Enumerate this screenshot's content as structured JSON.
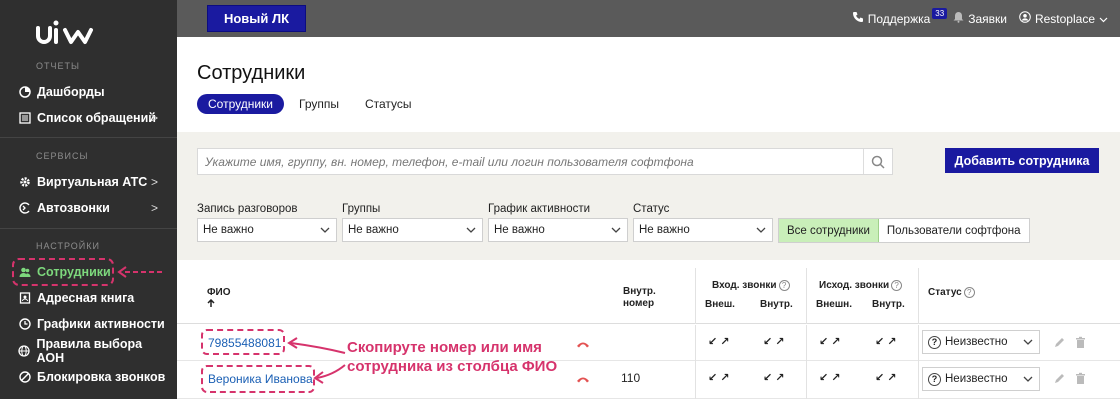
{
  "sidebar": {
    "logo_text": "uis",
    "sections": [
      {
        "title": "ОТЧЕТЫ"
      },
      {
        "title": "СЕРВИСЫ"
      },
      {
        "title": "НАСТРОЙКИ"
      }
    ],
    "items": [
      {
        "label": "Дашборды",
        "icon": "pie-chart-icon"
      },
      {
        "label": "Список обращений",
        "icon": "list-icon",
        "chevron": ">"
      },
      {
        "label": "Виртуальная АТС",
        "icon": "gear-icon",
        "chevron": ">"
      },
      {
        "label": "Автозвонки",
        "icon": "autocall-icon",
        "chevron": ">"
      },
      {
        "label": "Сотрудники",
        "icon": "users-icon"
      },
      {
        "label": "Адресная книга",
        "icon": "book-icon"
      },
      {
        "label": "Графики активности",
        "icon": "clock-icon"
      },
      {
        "label": "Правила выбора АОН",
        "icon": "globe-icon"
      },
      {
        "label": "Блокировка звонков",
        "icon": "block-icon"
      }
    ]
  },
  "topbar": {
    "new_lk": "Новый ЛК",
    "support": "Поддержка",
    "badge": "33",
    "requests": "Заявки",
    "account": "Restoplace"
  },
  "page": {
    "title": "Сотрудники",
    "tabs": [
      "Сотрудники",
      "Группы",
      "Статусы"
    ]
  },
  "filters": {
    "search_placeholder": "Укажите имя, группу, вн. номер, телефон, e-mail или логин пользователя софтфона",
    "add_button": "Добавить сотрудника",
    "labels": [
      "Запись разговоров",
      "Группы",
      "График активности",
      "Статус"
    ],
    "values": [
      "Не важно",
      "Не важно",
      "Не важно",
      "Не важно"
    ],
    "segment": [
      "Все сотрудники",
      "Пользователи софтфона"
    ]
  },
  "table": {
    "headers": {
      "fio": "ФИО",
      "sort": "🠙",
      "ext_1": "Внутр.",
      "ext_2": "номер",
      "incoming": "Вход. звонки",
      "outgoing": "Исход. звонки",
      "ext_out": "Внешн.",
      "int_out": "Внутр.",
      "ext_in": "Внеш.",
      "int_in": "Внутр.",
      "status": "Статус",
      "hint": "?"
    },
    "rows": [
      {
        "name": "79855488081",
        "ext": "",
        "status": "Неизвестно"
      },
      {
        "name": "Вероника Иванова",
        "ext": "110",
        "status": "Неизвестно"
      }
    ],
    "arrow_glyph": "↙ ↗"
  },
  "annotation": {
    "line1": "Скопируте номер или имя",
    "line2": "сотрудника из столбца ФИО"
  },
  "colors": {
    "accent": "#1a1aa0",
    "highlight": "#d6336c",
    "active_green": "#7dd87d"
  }
}
